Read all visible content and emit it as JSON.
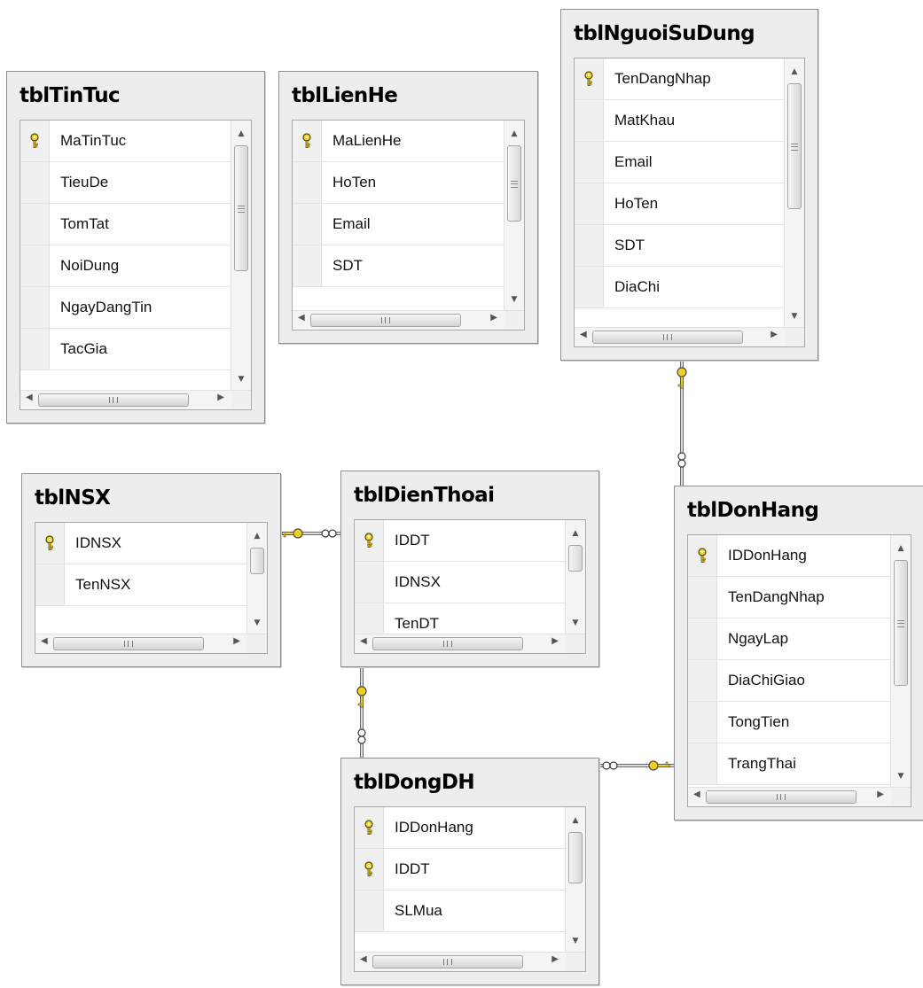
{
  "tables": {
    "tintuc": {
      "name": "tblTinTuc",
      "columns": [
        {
          "name": "MaTinTuc",
          "pk": true
        },
        {
          "name": "TieuDe",
          "pk": false
        },
        {
          "name": "TomTat",
          "pk": false
        },
        {
          "name": "NoiDung",
          "pk": false
        },
        {
          "name": "NgayDangTin",
          "pk": false
        },
        {
          "name": "TacGia",
          "pk": false
        }
      ]
    },
    "lienhe": {
      "name": "tblLienHe",
      "columns": [
        {
          "name": "MaLienHe",
          "pk": true
        },
        {
          "name": "HoTen",
          "pk": false
        },
        {
          "name": "Email",
          "pk": false
        },
        {
          "name": "SDT",
          "pk": false
        }
      ]
    },
    "nguoisudung": {
      "name": "tblNguoiSuDung",
      "columns": [
        {
          "name": "TenDangNhap",
          "pk": true
        },
        {
          "name": "MatKhau",
          "pk": false
        },
        {
          "name": "Email",
          "pk": false
        },
        {
          "name": "HoTen",
          "pk": false
        },
        {
          "name": "SDT",
          "pk": false
        },
        {
          "name": "DiaChi",
          "pk": false
        }
      ]
    },
    "nsx": {
      "name": "tblNSX",
      "columns": [
        {
          "name": "IDNSX",
          "pk": true
        },
        {
          "name": "TenNSX",
          "pk": false
        }
      ]
    },
    "dienthoai": {
      "name": "tblDienThoai",
      "columns": [
        {
          "name": "IDDT",
          "pk": true
        },
        {
          "name": "IDNSX",
          "pk": false
        },
        {
          "name": "TenDT",
          "pk": false
        }
      ]
    },
    "donhang": {
      "name": "tblDonHang",
      "columns": [
        {
          "name": "IDDonHang",
          "pk": true
        },
        {
          "name": "TenDangNhap",
          "pk": false
        },
        {
          "name": "NgayLap",
          "pk": false
        },
        {
          "name": "DiaChiGiao",
          "pk": false
        },
        {
          "name": "TongTien",
          "pk": false
        },
        {
          "name": "TrangThai",
          "pk": false
        }
      ]
    },
    "dongdh": {
      "name": "tblDongDH",
      "columns": [
        {
          "name": "IDDonHang",
          "pk": true
        },
        {
          "name": "IDDT",
          "pk": true
        },
        {
          "name": "SLMua",
          "pk": false
        }
      ]
    }
  },
  "scroll_grip_label": "III",
  "relationships": [
    {
      "from": "tblNSX",
      "to": "tblDienThoai"
    },
    {
      "from": "tblNguoiSuDung",
      "to": "tblDonHang"
    },
    {
      "from": "tblDienThoai",
      "to": "tblDongDH"
    },
    {
      "from": "tblDonHang",
      "to": "tblDongDH"
    }
  ],
  "colors": {
    "key": "#f2d01e",
    "line": "#6b6b6b",
    "panel": "#ededed"
  }
}
